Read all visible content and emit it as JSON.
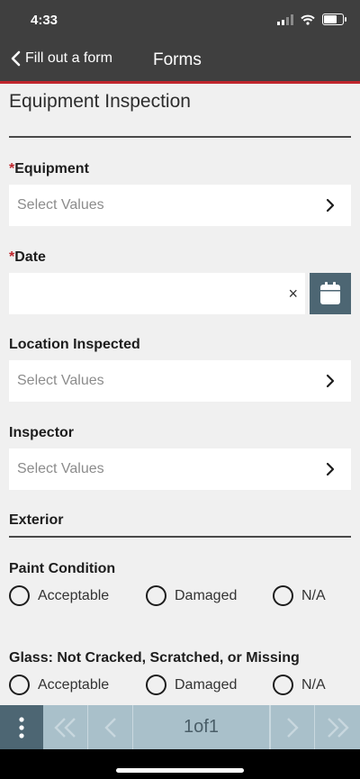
{
  "status": {
    "time": "4:33"
  },
  "header": {
    "back_label": "Fill out a form",
    "title": "Forms"
  },
  "form": {
    "title": "Equipment Inspection",
    "required_mark": "*",
    "equipment": {
      "label": "Equipment",
      "placeholder": "Select Values"
    },
    "date": {
      "label": "Date",
      "value": "",
      "clear": "×"
    },
    "location": {
      "label": "Location Inspected",
      "placeholder": "Select Values"
    },
    "inspector": {
      "label": "Inspector",
      "placeholder": "Select Values"
    },
    "section_exterior": "Exterior",
    "paint": {
      "label": "Paint Condition",
      "options": [
        "Acceptable",
        "Damaged",
        "N/A"
      ]
    },
    "glass": {
      "label": "Glass: Not Cracked, Scratched, or Missing",
      "options": [
        "Acceptable",
        "Damaged",
        "N/A"
      ]
    }
  },
  "pager": {
    "page_text": "1of1"
  },
  "colors": {
    "header_bg": "#3f3f3f",
    "accent_red": "#c0262d",
    "pager_bg": "#a9c0ca",
    "button_dark": "#4d6673"
  },
  "icons": [
    "chevron-left-icon",
    "chevron-right-icon",
    "calendar-icon",
    "close-icon",
    "more-vertical-icon",
    "double-chevron-left-icon",
    "double-chevron-right-icon"
  ]
}
